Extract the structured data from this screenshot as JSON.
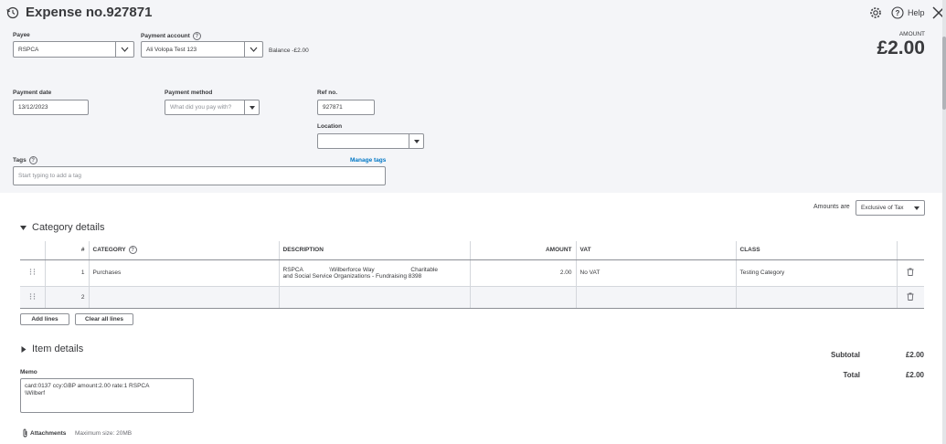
{
  "header": {
    "title": "Expense no.927871",
    "help_label": "Help",
    "amount_label": "AMOUNT",
    "amount_value": "£2.00"
  },
  "payee": {
    "label": "Payee",
    "value": "RSPCA"
  },
  "payment_account": {
    "label": "Payment account",
    "value": "Ali Volopa Test 123",
    "balance": "Balance -£2.00"
  },
  "payment_date": {
    "label": "Payment date",
    "value": "13/12/2023"
  },
  "payment_method": {
    "label": "Payment method",
    "placeholder": "What did you pay with?"
  },
  "ref_no": {
    "label": "Ref no.",
    "value": "927871"
  },
  "location": {
    "label": "Location",
    "value": ""
  },
  "tags": {
    "label": "Tags",
    "placeholder": "Start typing to add a tag",
    "manage_label": "Manage tags"
  },
  "amounts_are": {
    "label": "Amounts are",
    "value": "Exclusive of Tax"
  },
  "category_details": {
    "title": "Category details",
    "columns": [
      "#",
      "CATEGORY",
      "DESCRIPTION",
      "AMOUNT",
      "VAT",
      "CLASS"
    ],
    "rows": [
      {
        "num": "1",
        "category": "Purchases",
        "description_line1": "RSPCA                \\Wilberforce Way                      Charitable",
        "description_line2": "and Social Service Organizations - Fundraising 8398",
        "amount": "2.00",
        "vat": "No VAT",
        "class": "Testing Category"
      },
      {
        "num": "2",
        "category": "",
        "description_line1": "",
        "description_line2": "",
        "amount": "",
        "vat": "",
        "class": ""
      }
    ],
    "add_lines_label": "Add lines",
    "clear_lines_label": "Clear all lines"
  },
  "item_details": {
    "title": "Item details"
  },
  "totals": {
    "subtotal_label": "Subtotal",
    "subtotal_value": "£2.00",
    "total_label": "Total",
    "total_value": "£2.00"
  },
  "memo": {
    "label": "Memo",
    "line1": "card:0137 ccy:GBP amount:2.00 rate:1 RSPCA",
    "line2": "\\Wilberf"
  },
  "attachments": {
    "label": "Attachments",
    "max_size": "Maximum size: 20MB"
  },
  "colors": {
    "link": "#0077c5",
    "header_bg": "#f4f5f8",
    "text": "#393a3d"
  }
}
